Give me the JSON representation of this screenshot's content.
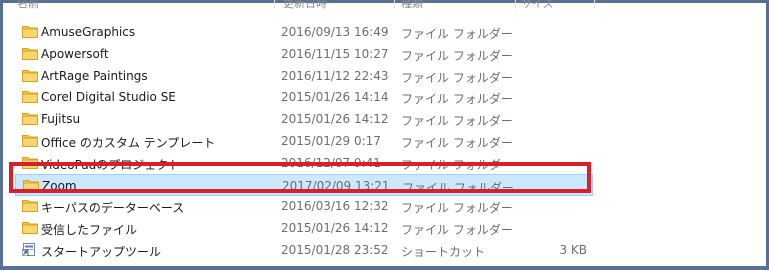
{
  "columns": {
    "name": "名前",
    "date": "更新日時",
    "type": "種類",
    "size": "サイズ"
  },
  "files": [
    {
      "name": "AmuseGraphics",
      "date": "2016/09/13 16:49",
      "type": "ファイル フォルダー",
      "size": "",
      "icon": "folder-icon",
      "selected": false
    },
    {
      "name": "Apowersoft",
      "date": "2016/11/15 10:27",
      "type": "ファイル フォルダー",
      "size": "",
      "icon": "folder-icon",
      "selected": false
    },
    {
      "name": "ArtRage Paintings",
      "date": "2016/11/12 22:43",
      "type": "ファイル フォルダー",
      "size": "",
      "icon": "folder-icon",
      "selected": false
    },
    {
      "name": "Corel Digital Studio SE",
      "date": "2015/01/26 14:14",
      "type": "ファイル フォルダー",
      "size": "",
      "icon": "folder-icon",
      "selected": false
    },
    {
      "name": "Fujitsu",
      "date": "2015/01/26 14:12",
      "type": "ファイル フォルダー",
      "size": "",
      "icon": "folder-icon",
      "selected": false
    },
    {
      "name": "Office のカスタム テンプレート",
      "date": "2015/01/29 0:17",
      "type": "ファイル フォルダー",
      "size": "",
      "icon": "folder-icon",
      "selected": false
    },
    {
      "name": "VideoPadのプロジェクト",
      "date": "2016/12/07 9:41",
      "type": "ファイル フォルダー",
      "size": "",
      "icon": "folder-icon",
      "selected": false
    },
    {
      "name": "Zoom",
      "date": "2017/02/09 13:21",
      "type": "ファイル フォルダー",
      "size": "",
      "icon": "folder-icon",
      "selected": true
    },
    {
      "name": "キーパスのデーターベース",
      "date": "2016/03/16 12:32",
      "type": "ファイル フォルダー",
      "size": "",
      "icon": "folder-icon",
      "selected": false
    },
    {
      "name": "受信したファイル",
      "date": "2015/01/26 14:12",
      "type": "ファイル フォルダー",
      "size": "",
      "icon": "folder-icon",
      "selected": false
    },
    {
      "name": "スタートアップツール",
      "date": "2015/01/28 23:52",
      "type": "ショートカット",
      "size": "3 KB",
      "icon": "shortcut-icon",
      "selected": false
    }
  ],
  "colors": {
    "frame": "#5a6f96",
    "highlight_border": "#d8202b",
    "selection_fill": "#cce8ff",
    "folder": "#f2c54b"
  }
}
